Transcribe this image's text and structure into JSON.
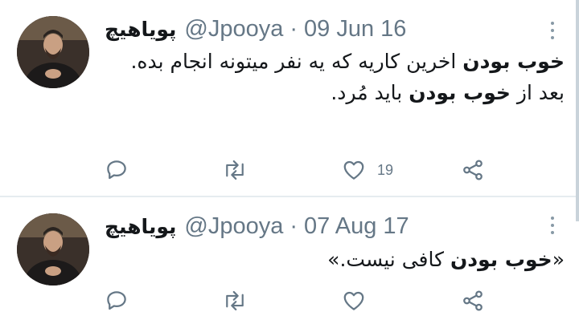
{
  "tweets": [
    {
      "author_name": "پویاهیچ",
      "handle": "@Jpooya",
      "separator": "·",
      "date": "09 Jun 16",
      "body_lines": [
        {
          "bold": "خوب بودن",
          "rest": " اخرین کاریه که یه نفر میتونه انجام بده."
        },
        {
          "pre": "بعد از ",
          "bold": "خوب بودن",
          "rest": " باید مُرد."
        }
      ],
      "like_count": "19"
    },
    {
      "author_name": "پویاهیچ",
      "handle": "@Jpooya",
      "separator": "·",
      "date": "07 Aug 17",
      "body_lines": [
        {
          "pre": "«",
          "bold": "خوب بودن",
          "rest": " کافی نیست.»"
        }
      ],
      "like_count": ""
    }
  ],
  "icons": {
    "reply": "reply-icon",
    "retweet": "retweet-icon",
    "like": "heart-icon",
    "share": "share-icon",
    "more": "more-options-icon"
  },
  "colors": {
    "icon": "#657786",
    "text": "#14171a",
    "divider": "#e6ecf0"
  }
}
